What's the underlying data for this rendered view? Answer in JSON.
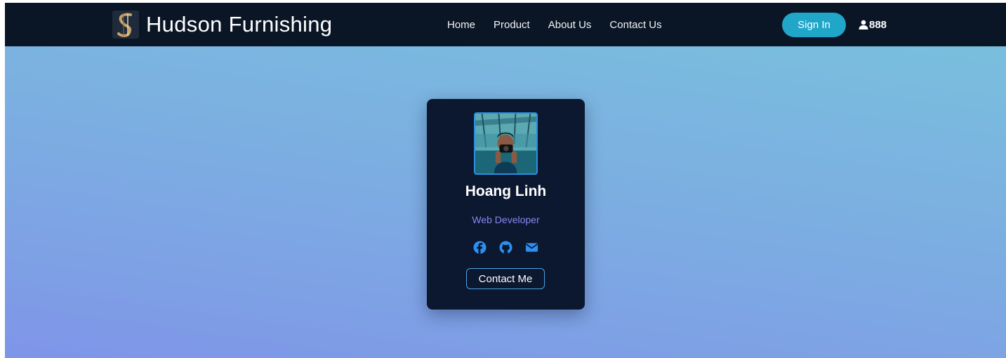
{
  "navbar": {
    "brand_name": "Hudson Furnishing",
    "links": [
      "Home",
      "Product",
      "About Us",
      "Contact Us"
    ],
    "signin_label": "Sign In",
    "cart_count": "888",
    "icons": {
      "logo": "hudson-logo",
      "cart": "user-icon"
    }
  },
  "profile_card": {
    "name": "Hoang Linh",
    "role": "Web Developer",
    "contact_label": "Contact Me",
    "social_icons": [
      "facebook-icon",
      "github-icon",
      "envelope-icon"
    ]
  },
  "colors": {
    "navbar_bg": "#0a1626",
    "signin_bg": "#1fa6c9",
    "card_bg": "#0b1830",
    "role_text": "#8a86f0",
    "social_icon": "#2e8ff0",
    "hero_gradient": [
      "#7f95e8",
      "#79bfdd"
    ]
  }
}
